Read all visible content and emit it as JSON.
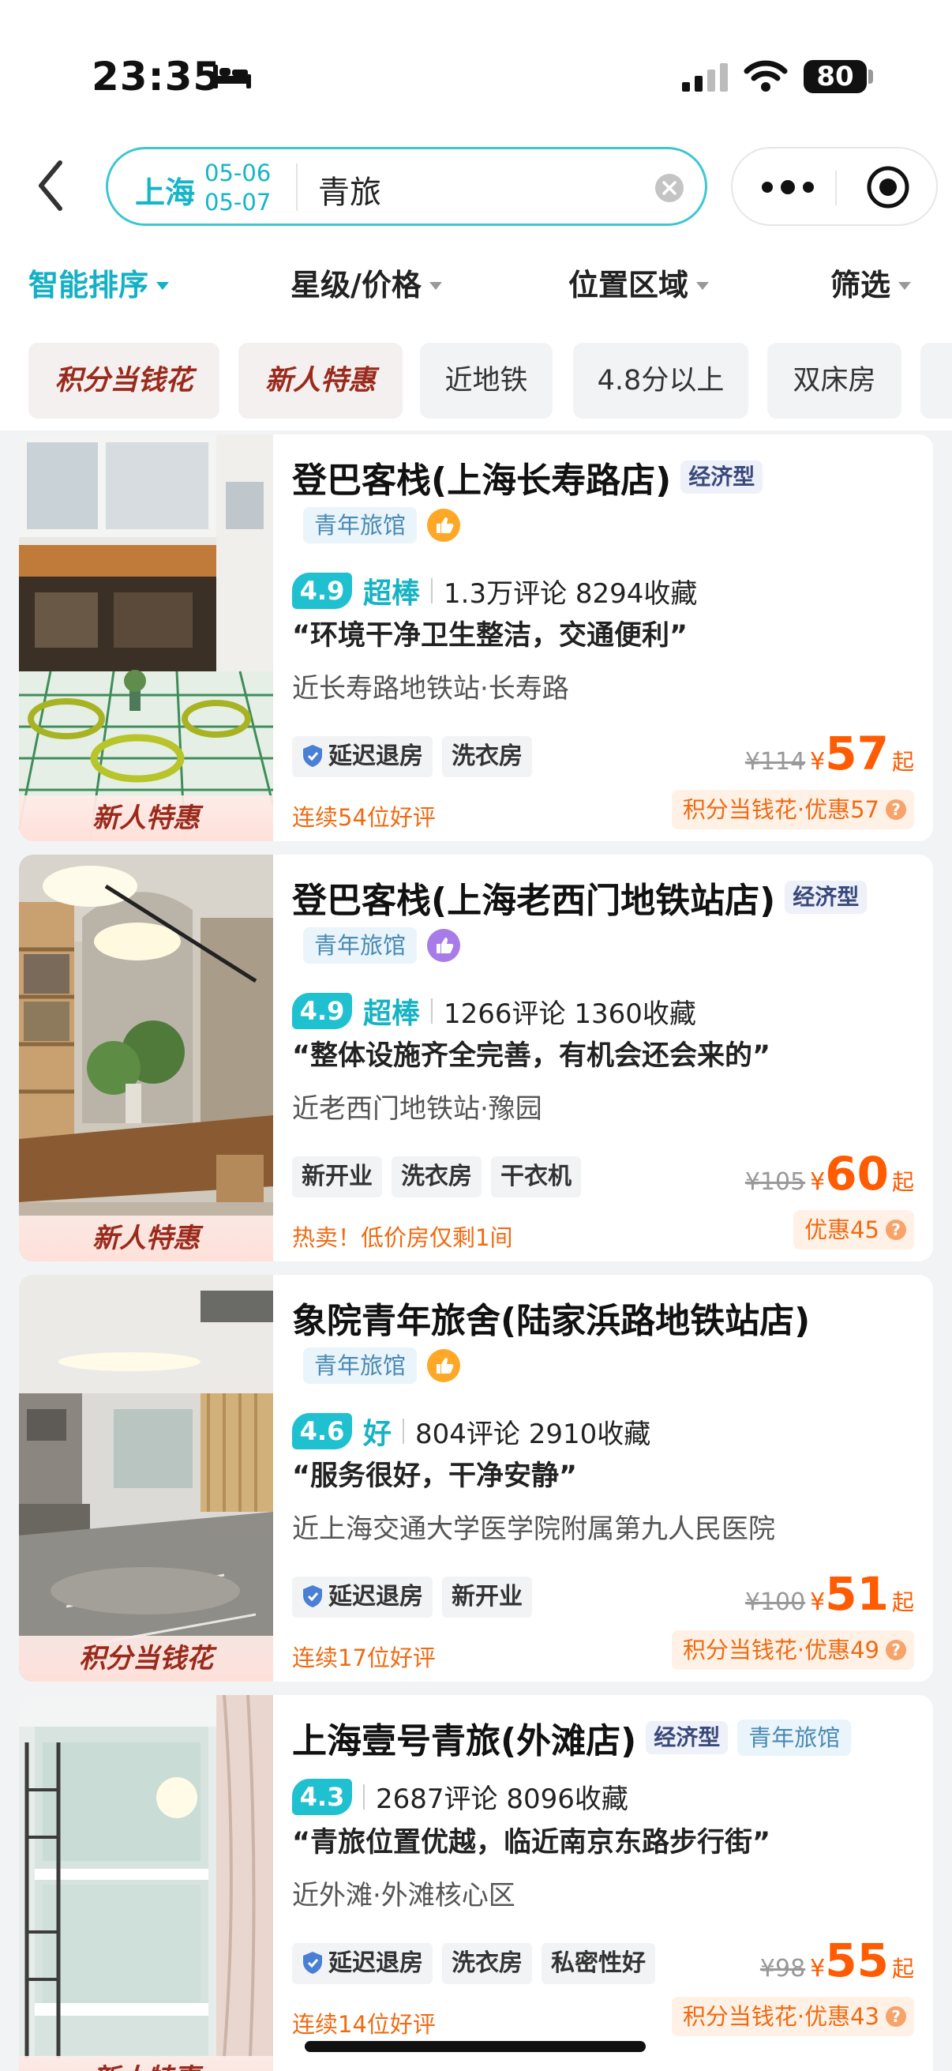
{
  "status_bar": {
    "time": "23:35",
    "battery": "80"
  },
  "search": {
    "city": "上海",
    "checkin": "05-06",
    "checkout": "05-07",
    "query": "青旅"
  },
  "sort_bar": [
    {
      "label": "智能排序",
      "active": true
    },
    {
      "label": "星级/价格",
      "active": false
    },
    {
      "label": "位置区域",
      "active": false
    },
    {
      "label": "筛选",
      "active": false
    }
  ],
  "filter_chips": [
    "积分当钱花",
    "新人特惠",
    "近地铁",
    "4.8分以上",
    "双床房"
  ],
  "hotels": [
    {
      "name": "登巴客栈(上海长寿路店)",
      "type_tag": "经济型",
      "category": "青年旅馆",
      "photo_tag": "新人特惠",
      "score": "4.9",
      "grade": "超棒",
      "stats": "1.3万评论 8294收藏",
      "quote": "“环境干净卫生整洁，交通便利”",
      "location": "近长寿路地铁站·长寿路",
      "features": [
        "延迟退房",
        "洗衣房"
      ],
      "note": "连续54位好评",
      "original_price": "¥114",
      "price": "57",
      "price_suffix": "起",
      "promo": "积分当钱花·优惠57"
    },
    {
      "name": "登巴客栈(上海老西门地铁站店)",
      "type_tag": "经济型",
      "category": "青年旅馆",
      "photo_tag": "新人特惠",
      "score": "4.9",
      "grade": "超棒",
      "stats": "1266评论 1360收藏",
      "quote": "“整体设施齐全完善，有机会还会来的”",
      "location": "近老西门地铁站·豫园",
      "features": [
        "新开业",
        "洗衣房",
        "干衣机"
      ],
      "note": "热卖！低价房仅剩1间",
      "original_price": "¥105",
      "price": "60",
      "price_suffix": "起",
      "promo": "优惠45"
    },
    {
      "name": "象院青年旅舍(陆家浜路地铁站店)",
      "type_tag": "",
      "category": "青年旅馆",
      "photo_tag": "积分当钱花",
      "score": "4.6",
      "grade": "好",
      "stats": "804评论 2910收藏",
      "quote": "“服务很好，干净安静”",
      "location": "近上海交通大学医学院附属第九人民医院",
      "features": [
        "延迟退房",
        "新开业"
      ],
      "note": "连续17位好评",
      "original_price": "¥100",
      "price": "51",
      "price_suffix": "起",
      "promo": "积分当钱花·优惠49"
    },
    {
      "name": "上海壹号青旅(外滩店)",
      "type_tag": "经济型",
      "category": "青年旅馆",
      "photo_tag": "新人特惠",
      "score": "4.3",
      "grade": "",
      "stats": "2687评论 8096收藏",
      "quote": "“青旅位置优越，临近南京东路步行街”",
      "location": "近外滩·外滩核心区",
      "features": [
        "延迟退房",
        "洗衣房",
        "私密性好"
      ],
      "note": "连续14位好评",
      "original_price": "¥98",
      "price": "55",
      "price_suffix": "起",
      "promo": "积分当钱花·优惠43"
    }
  ],
  "colors": {
    "accent": "#14b0c6",
    "price": "#ff5b00",
    "promo_text": "#9a2a1c"
  }
}
